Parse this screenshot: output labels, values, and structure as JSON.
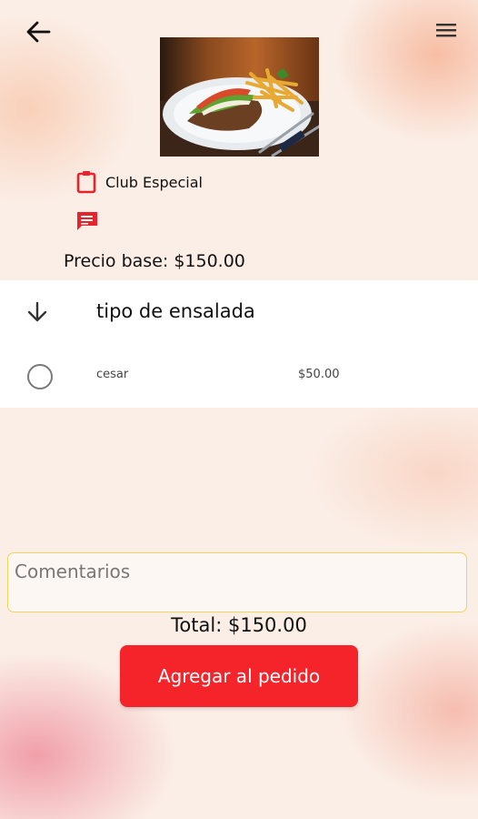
{
  "header": {
    "back_icon": "arrow-left-icon",
    "menu_icon": "hamburger-menu-icon"
  },
  "product": {
    "name": "Club Especial",
    "base_price_label": "Precio base: $150.00",
    "name_icon": "clipboard-icon",
    "description_icon": "message-list-icon"
  },
  "options": {
    "group_title": "tipo de ensalada",
    "items": [
      {
        "name": "cesar",
        "price": "$50.00",
        "selected": false
      }
    ]
  },
  "comments": {
    "placeholder": "Comentarios",
    "value": ""
  },
  "footer": {
    "total_label": "Total: $150.00",
    "add_button_label": "Agregar al pedido"
  },
  "colors": {
    "accent": "#f5242a",
    "comment_border": "#f1d45a"
  }
}
